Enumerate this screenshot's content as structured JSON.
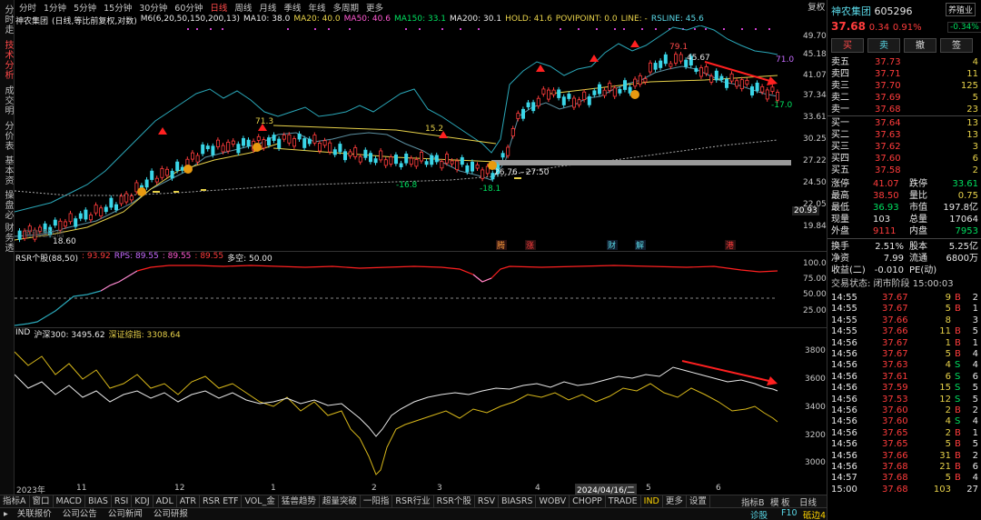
{
  "side_tabs": [
    "分时走势",
    "技术分析",
    "成交明细",
    "分价表",
    "基本资料",
    "操盘必读",
    "财务透视"
  ],
  "period_bar": [
    "分时",
    "1分钟",
    "5分钟",
    "15分钟",
    "30分钟",
    "60分钟",
    "日线",
    "周线",
    "月线",
    "季线",
    "年线",
    "多周期",
    "更多"
  ],
  "period_active": "日线",
  "tools": [
    "复权",
    "叠加",
    "多股",
    "统计",
    "画线",
    "标记",
    "◀",
    "▶"
  ],
  "legend_main": {
    "name": "神农集团",
    "mode": "(日线,等比前复权,对数)",
    "ma_title": "M6(6,20,50,150,200,13)",
    "ma10": "MA10: 38.0",
    "ma20": "MA20: 40.0",
    "ma50": "MA50: 40.6",
    "ma150": "MA150: 33.1",
    "ma200": "MA200: 30.1",
    "hold": "HOLD: 41.6",
    "pivot": "POVIPOINT: 0.0",
    "line": "LINE: -",
    "rsline": "RSLINE: 45.6"
  },
  "price_axis": [
    "49.70",
    "45.18",
    "41.07",
    "37.34",
    "33.61",
    "30.25",
    "27.22",
    "24.50",
    "22.05",
    "19.84"
  ],
  "price_axis_current": "20.93",
  "annotations": {
    "a713": "71.3",
    "a152": "15.2",
    "a791": "79.1",
    "a4567": "45.67",
    "a710": "71.0",
    "a170": "-17.0",
    "a168": "-16.8",
    "a181": "-18.1",
    "a2676": "26.76 - 27.50",
    "a1860": "18.60",
    "watermark": "用到通达信"
  },
  "event_tags": [
    "腾",
    "涨",
    "财",
    "解",
    "港"
  ],
  "legend_rsr": {
    "title": "RSR个股(88,50)",
    "v1": ": 93.92",
    "rps": "RPS: 89.55",
    "v2": ": 89.55",
    "v3": ": 89.55",
    "dk": "多空: 50.00"
  },
  "rsr_axis": [
    "100.0",
    "75.00",
    "50.00",
    "25.00"
  ],
  "legend_ind": {
    "title": "IND",
    "hs300": "沪深300: 3495.62",
    "szzs": "深证综指: 3308.64"
  },
  "ind_axis": [
    "3800",
    "3600",
    "3400",
    "3200",
    "3000"
  ],
  "x_axis": [
    "2023年",
    "11",
    "12",
    "1",
    "2",
    "3",
    "4",
    "2024/04/16/二",
    "5",
    "6"
  ],
  "bottom_tabs": [
    "指标A",
    "窗口",
    "MACD",
    "BIAS",
    "RSI",
    "KDJ",
    "ADL",
    "ATR",
    "RSR ETF",
    "VOL_金",
    "猛兽趋势",
    "超量突破",
    "一阳指",
    "RSR行业",
    "RSR个股",
    "RSV",
    "BIASRS",
    "WOBV",
    "CHOPP",
    "TRADE",
    "IND",
    "更多",
    "设置"
  ],
  "bottom_active": "IND",
  "bottom_right": [
    "指标B",
    "模",
    "板",
    "日线"
  ],
  "status_bar": [
    "关联报价",
    "公司公告",
    "公司新闻",
    "公司研报"
  ],
  "status_right": [
    "诊股",
    "F10",
    "砥边4"
  ],
  "quote": {
    "name": "神农集团",
    "code": "605296",
    "tag": "养殖业",
    "price": "37.68",
    "change": "0.34",
    "pct": "0.91%",
    "pct_tag": "-0.34%",
    "buttons": [
      "买",
      "卖",
      "撤",
      "签"
    ],
    "asks": [
      {
        "label": "卖五",
        "price": "37.73",
        "vol": "4"
      },
      {
        "label": "卖四",
        "price": "37.71",
        "vol": "11"
      },
      {
        "label": "卖三",
        "price": "37.70",
        "vol": "125"
      },
      {
        "label": "卖二",
        "price": "37.69",
        "vol": "5"
      },
      {
        "label": "卖一",
        "price": "37.68",
        "vol": "23"
      }
    ],
    "bids": [
      {
        "label": "买一",
        "price": "37.64",
        "vol": "13"
      },
      {
        "label": "买二",
        "price": "37.63",
        "vol": "13"
      },
      {
        "label": "买三",
        "price": "37.62",
        "vol": "3"
      },
      {
        "label": "买四",
        "price": "37.60",
        "vol": "6"
      },
      {
        "label": "买五",
        "price": "37.58",
        "vol": "2"
      }
    ],
    "stats": [
      {
        "l1": "涨停",
        "v1": "41.07",
        "c1": "red",
        "l2": "跌停",
        "v2": "33.61",
        "c2": "green"
      },
      {
        "l1": "最高",
        "v1": "38.50",
        "c1": "red",
        "l2": "量比",
        "v2": "0.75",
        "c2": "yellow"
      },
      {
        "l1": "最低",
        "v1": "36.93",
        "c1": "green",
        "l2": "市值",
        "v2": "197.8亿",
        "c2": "white"
      },
      {
        "l1": "现量",
        "v1": "103",
        "c1": "white",
        "l2": "总量",
        "v2": "17064",
        "c2": "white"
      },
      {
        "l1": "外盘",
        "v1": "9111",
        "c1": "red",
        "l2": "内盘",
        "v2": "7953",
        "c2": "green"
      }
    ],
    "stats2": [
      {
        "l1": "换手",
        "v1": "2.51%",
        "l2": "股本",
        "v2": "5.25亿"
      },
      {
        "l1": "净资",
        "v1": "7.99",
        "l2": "流通",
        "v2": "6800万"
      },
      {
        "l1": "收益(二)",
        "v1": "-0.010",
        "l2": "PE(动)",
        "v2": ""
      }
    ],
    "trade_status": "交易状态: 闭市阶段 15:00:03",
    "ticks": [
      {
        "t": "14:55",
        "p": "37.67",
        "v": "9",
        "d": "B",
        "n": "2"
      },
      {
        "t": "14:55",
        "p": "37.67",
        "v": "5",
        "d": "B",
        "n": "1"
      },
      {
        "t": "14:55",
        "p": "37.66",
        "v": "8",
        "d": "",
        "n": "3"
      },
      {
        "t": "14:55",
        "p": "37.66",
        "v": "11",
        "d": "B",
        "n": "5"
      },
      {
        "t": "14:56",
        "p": "37.67",
        "v": "1",
        "d": "B",
        "n": "1"
      },
      {
        "t": "14:56",
        "p": "37.67",
        "v": "5",
        "d": "B",
        "n": "4"
      },
      {
        "t": "14:56",
        "p": "37.63",
        "v": "4",
        "d": "S",
        "n": "4"
      },
      {
        "t": "14:56",
        "p": "37.61",
        "v": "6",
        "d": "S",
        "n": "6"
      },
      {
        "t": "14:56",
        "p": "37.59",
        "v": "15",
        "d": "S",
        "n": "5"
      },
      {
        "t": "14:56",
        "p": "37.53",
        "v": "12",
        "d": "S",
        "n": "5"
      },
      {
        "t": "14:56",
        "p": "37.60",
        "v": "2",
        "d": "B",
        "n": "2"
      },
      {
        "t": "14:56",
        "p": "37.60",
        "v": "4",
        "d": "S",
        "n": "4"
      },
      {
        "t": "14:56",
        "p": "37.65",
        "v": "2",
        "d": "B",
        "n": "1"
      },
      {
        "t": "14:56",
        "p": "37.65",
        "v": "5",
        "d": "B",
        "n": "5"
      },
      {
        "t": "14:56",
        "p": "37.66",
        "v": "31",
        "d": "B",
        "n": "2"
      },
      {
        "t": "14:56",
        "p": "37.68",
        "v": "21",
        "d": "B",
        "n": "6"
      },
      {
        "t": "14:57",
        "p": "37.68",
        "v": "5",
        "d": "B",
        "n": "4"
      },
      {
        "t": "15:00",
        "p": "37.68",
        "v": "103",
        "d": "",
        "n": "27"
      }
    ]
  }
}
